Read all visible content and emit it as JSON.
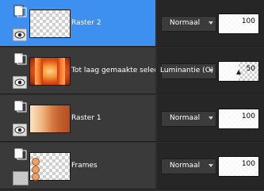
{
  "layers": [
    {
      "name": "Raster 2",
      "blend_mode": "Normaal",
      "opacity": 100,
      "selected": true,
      "visible": true
    },
    {
      "name": "Tot laag gemaakte selectie",
      "blend_mode": "Luminantie (O)",
      "opacity": 50,
      "selected": false,
      "visible": true
    },
    {
      "name": "Raster 1",
      "blend_mode": "Normaal",
      "opacity": 100,
      "selected": false,
      "visible": true
    },
    {
      "name": "Frames",
      "blend_mode": "Normaal",
      "opacity": 100,
      "selected": false,
      "visible": false
    }
  ],
  "colors": {
    "selected_row": "#3d8ff0",
    "row_bg": "#3a3a3a",
    "panel_bg": "#2d2d2d"
  },
  "icons": [
    "layer-doc-icon",
    "eye-icon",
    "lock-icon",
    "dropdown-arrow-icon"
  ]
}
